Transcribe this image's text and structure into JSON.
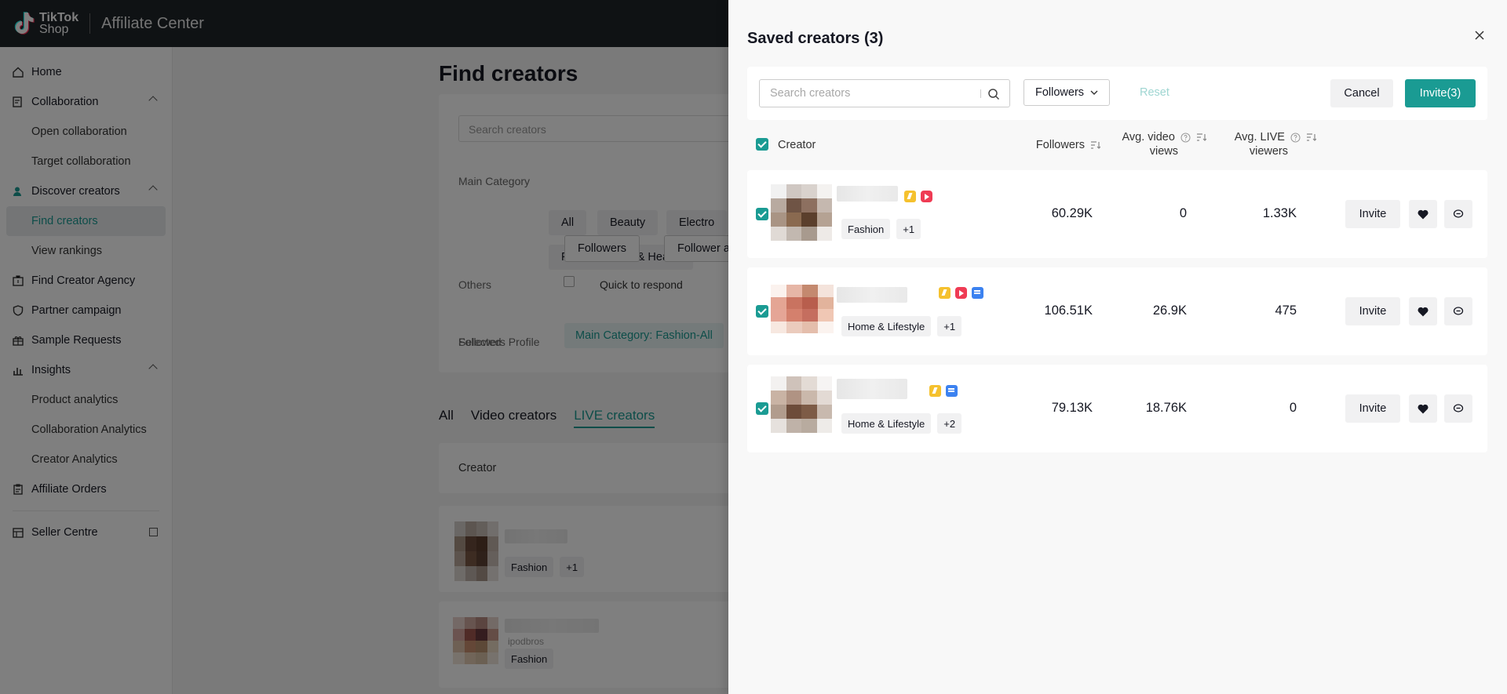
{
  "topbar": {
    "logo_line1": "TikTok",
    "logo_line2": "Shop",
    "app_title": "Affiliate Center"
  },
  "sidebar": {
    "home": "Home",
    "collaboration": "Collaboration",
    "open_collaboration": "Open collaboration",
    "target_collaboration": "Target collaboration",
    "discover_creators": "Discover creators",
    "find_creators": "Find creators",
    "view_rankings": "View rankings",
    "find_creator_agency": "Find Creator Agency",
    "partner_campaign": "Partner campaign",
    "sample_requests": "Sample Requests",
    "insights": "Insights",
    "product_analytics": "Product analytics",
    "collaboration_analytics": "Collaboration Analytics",
    "creator_analytics": "Creator Analytics",
    "affiliate_orders": "Affiliate Orders",
    "seller_centre": "Seller Centre"
  },
  "background": {
    "page_title": "Find creators",
    "search_placeholder": "Search creators",
    "main_category_label": "Main Category",
    "categories": [
      "All",
      "Beauty",
      "Electro",
      "Personal Care & Health"
    ],
    "followers_profile_label": "Followers Profile",
    "followers_btn": "Followers",
    "follower_btn2": "Follower a",
    "others_label": "Others",
    "quick_to_respond": "Quick to respond",
    "selected_label": "Selected",
    "selected_chip": "Main Category: Fashion-All",
    "tabs": [
      "All",
      "Video creators",
      "LIVE creators"
    ],
    "table_creator_header": "Creator",
    "row1_tags": [
      "Fashion",
      "+1"
    ],
    "row2_subname": "ipodbros",
    "row2_tags": [
      "Fashion"
    ]
  },
  "drawer": {
    "title": "Saved creators (3)",
    "search_placeholder": "Search creators",
    "followers_dropdown": "Followers",
    "reset": "Reset",
    "cancel": "Cancel",
    "invite_all": "Invite(3)",
    "headers": {
      "creator": "Creator",
      "followers": "Followers",
      "avg_video_views_1": "Avg. video",
      "avg_video_views_2": "views",
      "avg_live_viewers_1": "Avg. LIVE",
      "avg_live_viewers_2": "viewers"
    },
    "rows": [
      {
        "tags": [
          "Fashion",
          "+1"
        ],
        "followers": "60.29K",
        "avg_video_views": "0",
        "avg_live_viewers": "1.33K",
        "invite": "Invite",
        "badges": [
          "fast-response",
          "live"
        ]
      },
      {
        "tags": [
          "Home & Lifestyle",
          "+1"
        ],
        "followers": "106.51K",
        "avg_video_views": "26.9K",
        "avg_live_viewers": "475",
        "invite": "Invite",
        "badges": [
          "fast-response",
          "live",
          "video"
        ]
      },
      {
        "tags": [
          "Home & Lifestyle",
          "+2"
        ],
        "followers": "79.13K",
        "avg_video_views": "18.76K",
        "avg_live_viewers": "0",
        "invite": "Invite",
        "badges": [
          "fast-response",
          "video"
        ]
      }
    ]
  },
  "colors": {
    "brand_teal": "#1a9b93",
    "topbar_bg": "#1f2429",
    "badge_fast": "#f5c12e",
    "badge_live": "#ef3b54",
    "badge_video": "#3c82f0"
  }
}
